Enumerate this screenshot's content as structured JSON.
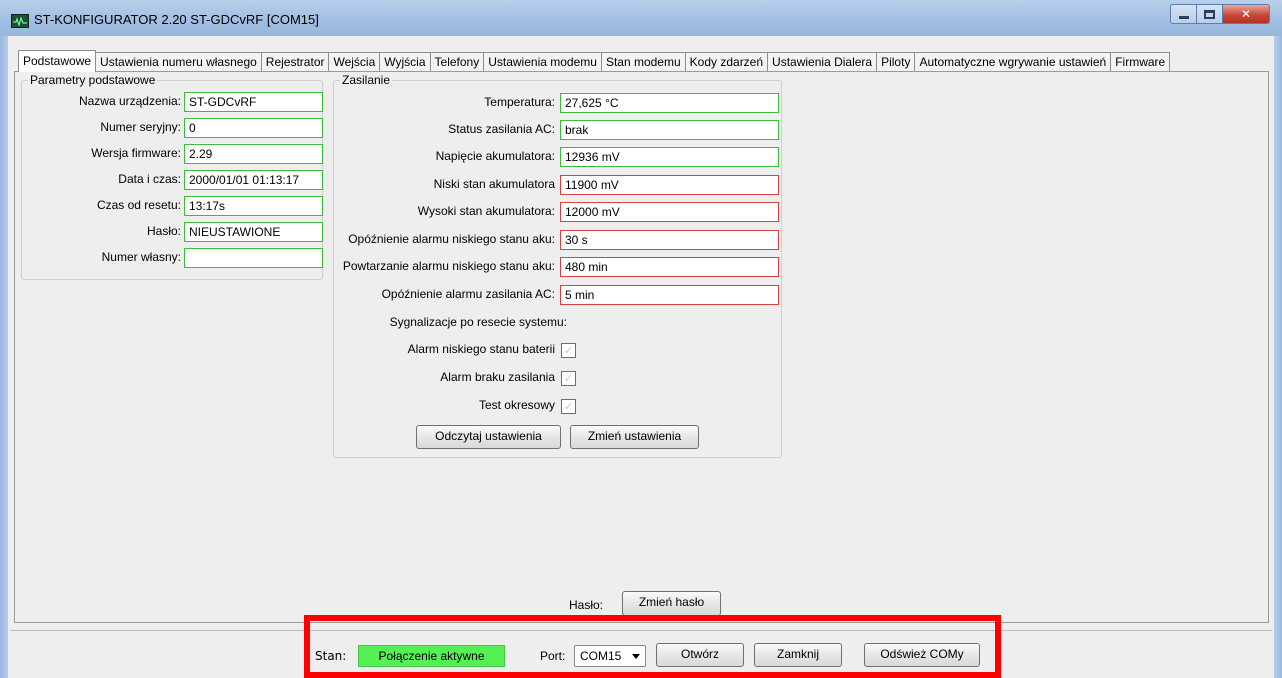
{
  "window": {
    "title": "ST-KONFIGURATOR 2.20 ST-GDCvRF  [COM15]"
  },
  "tabs": [
    {
      "label": "Podstawowe"
    },
    {
      "label": "Ustawienia numeru własnego"
    },
    {
      "label": "Rejestrator"
    },
    {
      "label": "Wejścia"
    },
    {
      "label": "Wyjścia"
    },
    {
      "label": "Telefony"
    },
    {
      "label": "Ustawienia modemu"
    },
    {
      "label": "Stan modemu"
    },
    {
      "label": "Kody zdarzeń"
    },
    {
      "label": "Ustawienia Dialera"
    },
    {
      "label": "Piloty"
    },
    {
      "label": "Automatyczne wgrywanie ustawień"
    },
    {
      "label": "Firmware"
    }
  ],
  "basic": {
    "title": "Parametry podstawowe",
    "rows": [
      {
        "label": "Nazwa urządzenia:",
        "value": "ST-GDCvRF"
      },
      {
        "label": "Numer seryjny:",
        "value": "0"
      },
      {
        "label": "Wersja firmware:",
        "value": "2.29"
      },
      {
        "label": "Data i czas:",
        "value": "2000/01/01 01:13:17"
      },
      {
        "label": "Czas od resetu:",
        "value": "13:17s"
      },
      {
        "label": "Hasło:",
        "value": "NIEUSTAWIONE"
      },
      {
        "label": "Numer własny:",
        "value": ""
      }
    ]
  },
  "power": {
    "title": "Zasilanie",
    "rows": [
      {
        "label": "Temperatura:",
        "value": "27,625 °C",
        "status": "ok"
      },
      {
        "label": "Status zasilania AC:",
        "value": "brak",
        "status": "ok"
      },
      {
        "label": "Napięcie akumulatora:",
        "value": "12936 mV",
        "status": "ok"
      },
      {
        "label": "Niski stan akumulatora",
        "value": "11900 mV",
        "status": "editable"
      },
      {
        "label": "Wysoki stan akumulatora:",
        "value": "12000 mV",
        "status": "editable"
      },
      {
        "label": "Opóźnienie alarmu niskiego stanu aku:",
        "value": "30 s",
        "status": "editable"
      },
      {
        "label": "Powtarzanie alarmu niskiego stanu aku:",
        "value": "480 min",
        "status": "editable"
      },
      {
        "label": "Opóźnienie alarmu zasilania AC:",
        "value": "5 min",
        "status": "editable"
      }
    ],
    "signals_label": "Sygnalizacje po resecie systemu:",
    "checkboxes": [
      {
        "label": "Alarm niskiego stanu baterii",
        "checked": true
      },
      {
        "label": "Alarm braku zasilania",
        "checked": true
      },
      {
        "label": "Test okresowy",
        "checked": true
      }
    ],
    "check_glyph": "✓",
    "read_button": "Odczytaj ustawienia",
    "change_button": "Zmień ustawienia"
  },
  "password": {
    "label": "Hasło:",
    "button": "Zmień hasło"
  },
  "status": {
    "state_label": "Stan:",
    "state_value": "Połączenie aktywne",
    "port_label": "Port:",
    "port_value": "COM15",
    "open_button": "Otwórz",
    "close_button": "Zamknij",
    "refresh_button": "Odśwież COMy"
  },
  "colors": {
    "ok_border": "#3bbf3b",
    "editable_border": "#d94040",
    "status_active": "#55f055",
    "highlight": "#ff0000"
  }
}
